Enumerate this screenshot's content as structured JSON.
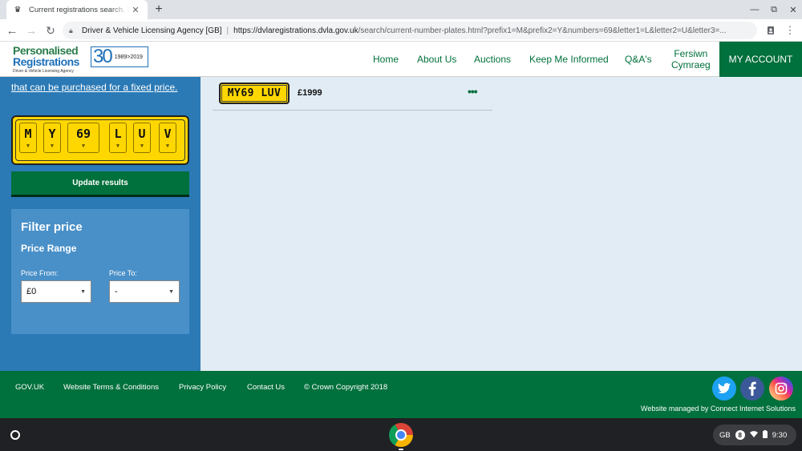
{
  "browser": {
    "tab_title": "Current registrations search. Search",
    "tab_close": "✕",
    "new_tab": "+",
    "window_controls": [
      "—",
      "⧉",
      "✕"
    ],
    "address": {
      "org": "Driver & Vehicle Licensing Agency [GB]",
      "separator": "|",
      "url_host": "https://dvlaregistrations.dvla.gov.uk",
      "url_rest": "/search/current-number-plates.html?prefix1=M&prefix2=Y&numbers=69&letter1=L&letter2=U&letter3=..."
    }
  },
  "header": {
    "logo_line1": "Personalised",
    "logo_line2": "Registrations",
    "logo_line3": "Driver & Vehicle Licensing Agency",
    "anniversary_number": "30",
    "anniversary_years": "1989>2019",
    "nav": {
      "home": "Home",
      "about": "About Us",
      "auctions": "Auctions",
      "keep_informed": "Keep Me Informed",
      "qa": "Q&A's",
      "welsh_line1": "Fersiwn",
      "welsh_line2": "Cymraeg",
      "my_account": "MY ACCOUNT"
    }
  },
  "sidebar": {
    "fixed_price_link": "that can be purchased for a fixed price.",
    "plate_chars": [
      "M",
      "Y",
      "69",
      "L",
      "U",
      "V"
    ],
    "update_button": "Update results",
    "filter": {
      "title": "Filter price",
      "subtitle": "Price Range",
      "from_label": "Price From:",
      "from_value": "£0",
      "to_label": "Price To:",
      "to_value": "-"
    }
  },
  "results": [
    {
      "plate": "MY69 LUV",
      "price": "£1999",
      "more": "•••"
    }
  ],
  "footer": {
    "links": [
      "GOV.UK",
      "Website Terms & Conditions",
      "Privacy Policy",
      "Contact Us",
      "© Crown Copyright 2018"
    ],
    "managed_by": "Website managed by Connect Internet Solutions",
    "social": [
      {
        "name": "twitter",
        "color": "#1da1f2"
      },
      {
        "name": "facebook",
        "color": "#3b5998"
      },
      {
        "name": "instagram",
        "color": "#d6249f"
      }
    ]
  },
  "shelf": {
    "tray_locale": "GB",
    "tray_notification_count": "8",
    "tray_time": "9:30"
  }
}
